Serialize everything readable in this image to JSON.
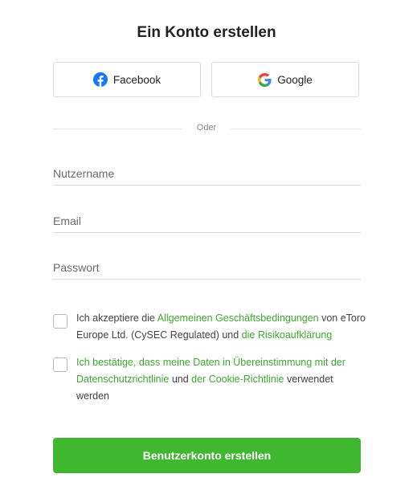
{
  "title": "Ein Konto erstellen",
  "social": {
    "facebook_label": "Facebook",
    "google_label": "Google"
  },
  "divider_text": "Oder",
  "fields": {
    "username_placeholder": "Nutzername",
    "email_placeholder": "Email",
    "password_placeholder": "Passwort"
  },
  "terms": {
    "pre": "Ich akzeptiere die ",
    "link1": "Allgemeinen Geschäftsbedingungen",
    "mid": " von eToro Europe Ltd. (CySEC Regulated) und ",
    "link2": "die Risikoaufklärung"
  },
  "privacy": {
    "link1": "Ich bestätige, dass meine Daten in Übereinstimmung mit der Datenschutzrichtlinie",
    "mid": " und ",
    "link2": "der Cookie-Richtlinie",
    "post": " verwendet werden"
  },
  "submit_label": "Benutzerkonto erstellen",
  "colors": {
    "accent_green": "#3fb72f",
    "link_green": "#3bab2d",
    "facebook_blue": "#1877f2"
  },
  "icons": {
    "facebook": "facebook-icon",
    "google": "google-icon"
  }
}
